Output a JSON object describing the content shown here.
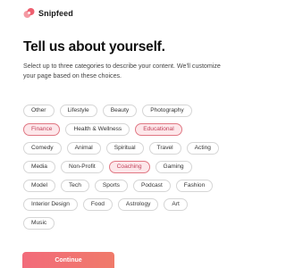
{
  "brand": {
    "name": "Snipfeed",
    "logo_icon": "snipfeed-logo-icon",
    "accent": "#f06b76"
  },
  "heading": {
    "title": "Tell us about yourself.",
    "subtitle": "Select up to three categories to describe your content. We'll customize your page based on these choices."
  },
  "categories": {
    "rows": [
      [
        {
          "label": "Other",
          "selected": false
        },
        {
          "label": "Lifestyle",
          "selected": false
        },
        {
          "label": "Beauty",
          "selected": false
        },
        {
          "label": "Photography",
          "selected": false
        }
      ],
      [
        {
          "label": "Finance",
          "selected": true
        },
        {
          "label": "Health & Wellness",
          "selected": false
        },
        {
          "label": "Educational",
          "selected": true
        }
      ],
      [
        {
          "label": "Comedy",
          "selected": false
        },
        {
          "label": "Animal",
          "selected": false
        },
        {
          "label": "Spiritual",
          "selected": false
        },
        {
          "label": "Travel",
          "selected": false
        },
        {
          "label": "Acting",
          "selected": false
        }
      ],
      [
        {
          "label": "Media",
          "selected": false
        },
        {
          "label": "Non-Profit",
          "selected": false
        },
        {
          "label": "Coaching",
          "selected": true
        },
        {
          "label": "Gaming",
          "selected": false
        }
      ],
      [
        {
          "label": "Model",
          "selected": false
        },
        {
          "label": "Tech",
          "selected": false
        },
        {
          "label": "Sports",
          "selected": false
        },
        {
          "label": "Podcast",
          "selected": false
        },
        {
          "label": "Fashion",
          "selected": false
        }
      ],
      [
        {
          "label": "Interior Design",
          "selected": false
        },
        {
          "label": "Food",
          "selected": false
        },
        {
          "label": "Astrology",
          "selected": false
        },
        {
          "label": "Art",
          "selected": false
        }
      ],
      [
        {
          "label": "Music",
          "selected": false
        }
      ]
    ],
    "selected_color": "#c2415a",
    "selected_bg": "#fde7ea"
  },
  "actions": {
    "continue_label": "Continue"
  }
}
